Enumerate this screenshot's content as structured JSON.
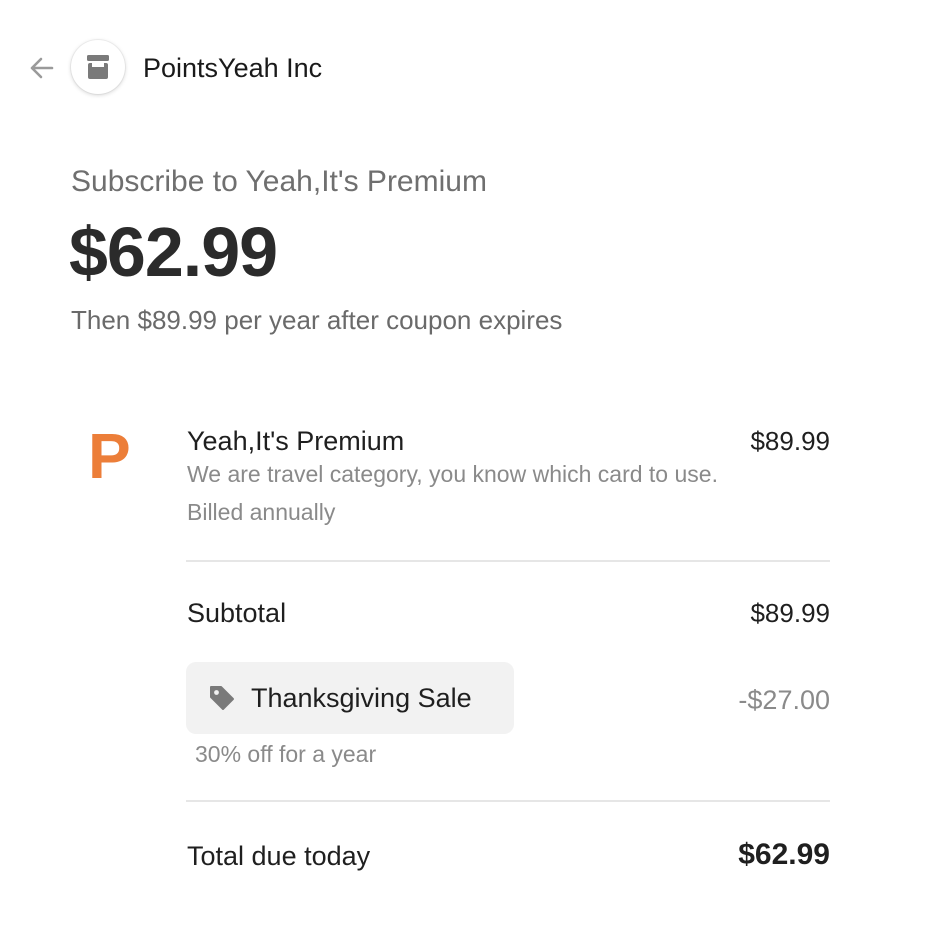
{
  "header": {
    "back_icon": "arrow-left-icon",
    "merchant_icon": "storefront-icon",
    "merchant_name": "PointsYeah Inc"
  },
  "summary": {
    "title": "Subscribe to Yeah,It's Premium",
    "amount": "$62.99",
    "after_text": "Then $89.99 per year after coupon expires"
  },
  "line_item": {
    "logo_letter": "P",
    "logo_color": "#ec7e39",
    "name": "Yeah,It's Premium",
    "price": "$89.99",
    "description": "We are travel category, you know which card to use.",
    "billing": "Billed annually"
  },
  "subtotal": {
    "label": "Subtotal",
    "value": "$89.99"
  },
  "coupon": {
    "icon": "tag-icon",
    "name": "Thanksgiving Sale",
    "discount": "-$27.00",
    "description": "30% off for a year"
  },
  "total": {
    "label": "Total due today",
    "value": "$62.99"
  }
}
